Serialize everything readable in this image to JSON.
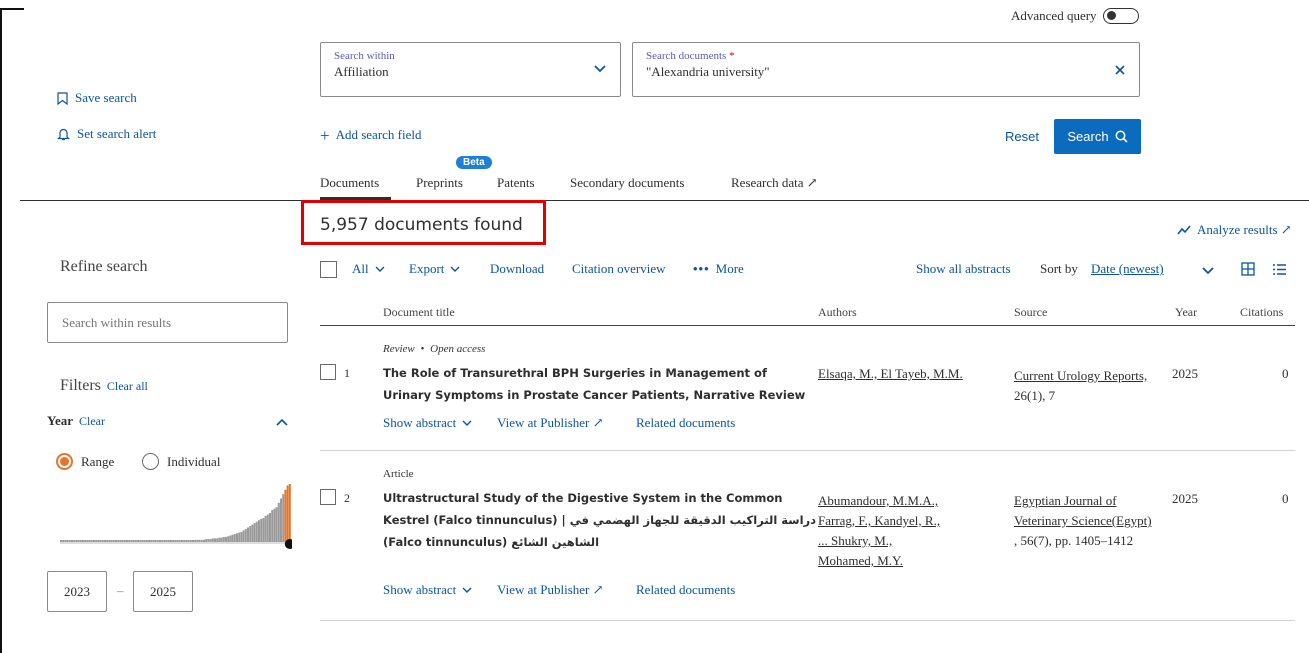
{
  "advanced_query_label": "Advanced query",
  "sidebar": {
    "save_search": "Save search",
    "set_alert": "Set search alert",
    "refine_title": "Refine search",
    "search_within_placeholder": "Search within results",
    "filters_title": "Filters",
    "clear_all": "Clear all",
    "year_label": "Year",
    "year_clear": "Clear",
    "range_label": "Range",
    "individual_label": "Individual",
    "year_from": "2023",
    "year_to": "2025",
    "year_dash": "–",
    "histogram": [
      1,
      1,
      1,
      1,
      1,
      1,
      1,
      1,
      1,
      1,
      1,
      1,
      1,
      1,
      1,
      1,
      1,
      1,
      1,
      1,
      1,
      1,
      1,
      1,
      1,
      1,
      1,
      1,
      1,
      1,
      1,
      1,
      1,
      1,
      1,
      1,
      1,
      1,
      1,
      1,
      1,
      1,
      1,
      1,
      1,
      1,
      1,
      1,
      1,
      1,
      1,
      1,
      1,
      2,
      2,
      2,
      2,
      2,
      2,
      2,
      2,
      3,
      3,
      3,
      3,
      3,
      4,
      4,
      4,
      5,
      5,
      5,
      6,
      6,
      7,
      7,
      8,
      9,
      10,
      11,
      12,
      13,
      14,
      16,
      18,
      20,
      22,
      24,
      26,
      28,
      30,
      32,
      33,
      36,
      38,
      40,
      44,
      46,
      48,
      54,
      60,
      66,
      72,
      78,
      80
    ]
  },
  "search": {
    "within_label": "Search within",
    "within_value": "Affiliation",
    "docs_label": "Search documents",
    "docs_required": "*",
    "docs_value": "\"Alexandria university\"",
    "add_field": "Add search field",
    "reset": "Reset",
    "search_button": "Search"
  },
  "tabs": [
    {
      "label": "Documents",
      "badge": ""
    },
    {
      "label": "Preprints",
      "badge": "Beta"
    },
    {
      "label": "Patents",
      "badge": ""
    },
    {
      "label": "Secondary documents",
      "badge": ""
    },
    {
      "label": "Research data ↗",
      "badge": ""
    }
  ],
  "results": {
    "count_text": "5,957 documents found",
    "analyze": "Analyze results ↗",
    "toolbar": {
      "all": "All",
      "export": "Export",
      "download": "Download",
      "citation_overview": "Citation overview",
      "more": "More",
      "show_all_abstracts": "Show all abstracts",
      "sort_by": "Sort by",
      "sort_value": "Date (newest)"
    },
    "columns": {
      "title": "Document title",
      "authors": "Authors",
      "source": "Source",
      "year": "Year",
      "citations": "Citations"
    },
    "rows": [
      {
        "num": "1",
        "type": "Review",
        "access": "Open access",
        "title_line1": "The Role of Transurethral BPH Surgeries in Management of",
        "title_line2": "Urinary Symptoms in Prostate Cancer Patients, Narrative Review",
        "title_line3": "",
        "authors": [
          "Elsaqa, M., El Tayeb, M.M."
        ],
        "source_line1": "Current Urology Reports,",
        "source_line2": "26(1), 7",
        "year": "2025",
        "citations": "0",
        "show_abstract": "Show abstract",
        "view_publisher": "View at Publisher ↗",
        "related": "Related documents"
      },
      {
        "num": "2",
        "type": "Article",
        "access": "",
        "title_line1": "Ultrastructural Study of the Digestive System in the Common",
        "title_line2": "Kestrel (Falco tinnunculus) | دراسة التراكيب الدقيقة للجهاز الهضمي في",
        "title_line3": "الشاهين الشائع (Falco tinnunculus)",
        "authors": [
          "Abumandour, M.M.A.,",
          "Farrag, F., Kandyel, R.,",
          "... Shukry, M.,",
          "Mohamed, M.Y."
        ],
        "source_line1": "Egyptian Journal of",
        "source_line2": "Veterinary Science(Egypt)",
        "source_line3": ", 56(7), pp. 1405–1412",
        "year": "2025",
        "citations": "0",
        "show_abstract": "Show abstract",
        "view_publisher": "View at Publisher ↗",
        "related": "Related documents"
      }
    ]
  },
  "colors": {
    "accent": "#0b6bbf",
    "highlight_box": "#e00000",
    "orange": "#e8742a"
  }
}
